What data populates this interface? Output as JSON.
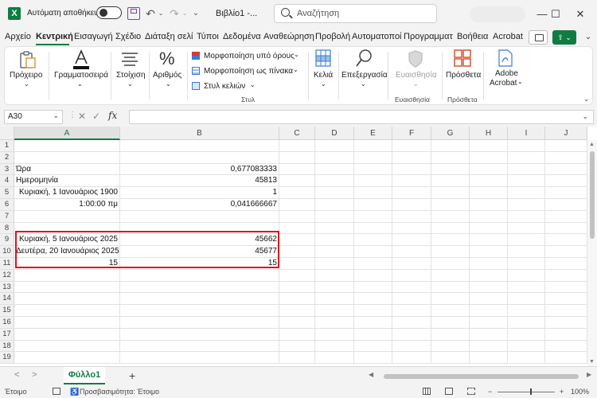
{
  "titlebar": {
    "autosave_label": "Αυτόματη αποθήκευση",
    "file_title": "Βιβλίο1  -...",
    "search_placeholder": "Αναζήτηση",
    "undo_icon": "↶",
    "redo_icon": "↷",
    "minimize": "—",
    "maximize": "☐",
    "close": "✕"
  },
  "menu": {
    "items": [
      "Αρχείο",
      "Κεντρική",
      "Εισαγωγή",
      "Σχέδιο",
      "Διάταξη σελί",
      "Τύποι",
      "Δεδομένα",
      "Αναθεώρηση",
      "Προβολή",
      "Αυτοματοποί",
      "Προγραμματ",
      "Βοήθεια",
      "Acrobat"
    ],
    "active_index": 1
  },
  "ribbon": {
    "paste": "Πρόχειρο",
    "font": "Γραμματοσειρά",
    "alignment": "Στοίχιση",
    "number": "Αριθμός",
    "conditional_formatting": "Μορφοποίηση υπό όρους",
    "format_as_table": "Μορφοποίηση ως πίνακα",
    "cell_styles": "Στυλ κελιών",
    "styles_group": "Στυλ",
    "cells": "Κελιά",
    "editing": "Επεξεργασία",
    "sensitivity": "Ευαισθησία",
    "sensitivity_group": "Ευαισθησία",
    "addins": "Πρόσθετα",
    "addins_group": "Πρόσθετα",
    "adobe_line1": "Adobe",
    "adobe_line2": "Acrobat",
    "chevron": "⌄"
  },
  "formulabar": {
    "name_box": "A30",
    "fx": "fx",
    "cancel": "✕",
    "enter": "✓",
    "formula": ""
  },
  "grid": {
    "columns": [
      "A",
      "B",
      "C",
      "D",
      "E",
      "F",
      "G",
      "H",
      "I",
      "J"
    ],
    "selected_column": "A",
    "rows": [
      "1",
      "2",
      "3",
      "4",
      "5",
      "6",
      "7",
      "8",
      "9",
      "10",
      "11",
      "12",
      "13",
      "14",
      "15",
      "16",
      "17",
      "18",
      "19"
    ],
    "cells": {
      "A3": "Ώρα",
      "B3": "0,677083333",
      "A4": "Ημερομηνία",
      "B4": "45813",
      "A5": "Κυριακή, 1 Ιανουάριος 1900",
      "B5": "1",
      "A6": "1:00:00 πμ",
      "B6": "0,041666667",
      "A9": "Κυριακή, 5 Ιανουάριος 2025",
      "B9": "45662",
      "A10": "Δευτέρα, 20 Ιανουάριος 2025",
      "B10": "45677",
      "A11": "15",
      "B11": "15"
    },
    "highlight_color": "#e0101a"
  },
  "sheets": {
    "tabs": [
      "Φύλλο1"
    ],
    "add": "+",
    "prev": "<",
    "next": ">"
  },
  "statusbar": {
    "ready": "Έτοιμο",
    "accessibility": "Προσβασιμότητα: Έτοιμο",
    "zoom_minus": "−",
    "zoom_plus": "+",
    "zoom": "100%"
  },
  "colors": {
    "excel_green": "#107c41",
    "highlight_red": "#e0101a"
  }
}
